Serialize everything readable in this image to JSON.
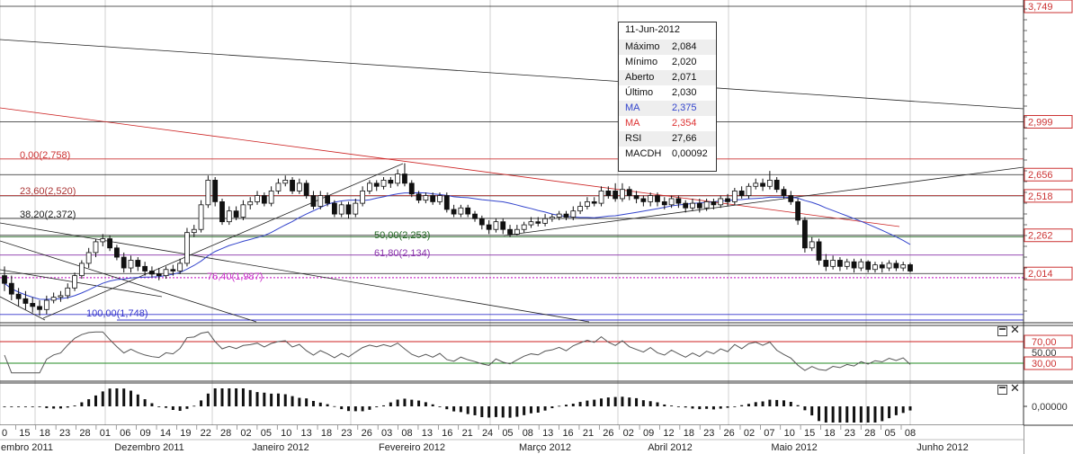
{
  "tooltip": {
    "date": "11-Jun-2012",
    "rows": [
      {
        "label": "Máximo",
        "value": "2,084",
        "color": "#111111"
      },
      {
        "label": "Mínimo",
        "value": "2,020",
        "color": "#111111"
      },
      {
        "label": "Aberto",
        "value": "2,071",
        "color": "#111111"
      },
      {
        "label": "Último",
        "value": "2,030",
        "color": "#111111"
      },
      {
        "label": "MA",
        "value": "2,375",
        "color": "#3344cc"
      },
      {
        "label": "MA",
        "value": "2,354",
        "color": "#dd3333"
      },
      {
        "label": "RSI",
        "value": "27,66",
        "color": "#111111"
      },
      {
        "label": "MACDH",
        "value": "0,00092",
        "color": "#111111"
      }
    ]
  },
  "chart_data": {
    "type": "candlestick",
    "price_axis": {
      "range": [
        1.7,
        3.79
      ],
      "ticks": [
        "3,749",
        "2,999",
        "2,656",
        "2,518",
        "2,262",
        "2,014"
      ]
    },
    "price_ticks_values": [
      3.749,
      2.999,
      2.656,
      2.518,
      2.262,
      2.014
    ],
    "fibonacci": [
      {
        "label": "0,00(2,758)",
        "value": 2.758,
        "color": "#cc3333"
      },
      {
        "label": "23,60(2,520)",
        "value": 2.52,
        "color": "#aa3333"
      },
      {
        "label": "38,20(2,372)",
        "value": 2.372,
        "color": "#222222"
      },
      {
        "label": "50,00(2,253)",
        "value": 2.253,
        "color": "#226622"
      },
      {
        "label": "61,80(2,134)",
        "value": 2.134,
        "color": "#8833aa"
      },
      {
        "label": "76,40(1,987)",
        "value": 1.987,
        "color": "#cc33cc"
      },
      {
        "label": "100,00(1,748)",
        "value": 1.748,
        "color": "#3333cc"
      }
    ],
    "candles": [
      [
        2.0,
        1.95,
        2.06,
        1.9
      ],
      [
        1.95,
        1.88,
        2.0,
        1.84
      ],
      [
        1.88,
        1.85,
        1.92,
        1.8
      ],
      [
        1.85,
        1.82,
        1.9,
        1.78
      ],
      [
        1.82,
        1.8,
        1.86,
        1.76
      ],
      [
        1.8,
        1.78,
        1.84,
        1.74
      ],
      [
        1.78,
        1.84,
        1.87,
        1.75
      ],
      [
        1.84,
        1.86,
        1.89,
        1.82
      ],
      [
        1.86,
        1.87,
        1.9,
        1.83
      ],
      [
        1.87,
        1.92,
        1.95,
        1.85
      ],
      [
        1.92,
        2.0,
        2.02,
        1.9
      ],
      [
        2.0,
        2.08,
        2.1,
        1.98
      ],
      [
        2.08,
        2.15,
        2.18,
        2.05
      ],
      [
        2.15,
        2.22,
        2.24,
        2.12
      ],
      [
        2.22,
        2.24,
        2.27,
        2.19
      ],
      [
        2.24,
        2.18,
        2.26,
        2.16
      ],
      [
        2.18,
        2.12,
        2.2,
        2.1
      ],
      [
        2.12,
        2.05,
        2.15,
        2.02
      ],
      [
        2.05,
        2.1,
        2.13,
        2.02
      ],
      [
        2.1,
        2.06,
        2.12,
        2.03
      ],
      [
        2.06,
        2.03,
        2.09,
        2.0
      ],
      [
        2.03,
        2.01,
        2.06,
        1.99
      ],
      [
        2.01,
        2.0,
        2.05,
        1.97
      ],
      [
        2.0,
        2.04,
        2.06,
        1.98
      ],
      [
        2.04,
        2.03,
        2.07,
        2.0
      ],
      [
        2.03,
        2.08,
        2.11,
        2.01
      ],
      [
        2.08,
        2.28,
        2.31,
        2.06
      ],
      [
        2.28,
        2.3,
        2.33,
        2.25
      ],
      [
        2.3,
        2.46,
        2.49,
        2.28
      ],
      [
        2.46,
        2.62,
        2.65,
        2.44
      ],
      [
        2.62,
        2.48,
        2.64,
        2.45
      ],
      [
        2.48,
        2.35,
        2.5,
        2.33
      ],
      [
        2.35,
        2.42,
        2.45,
        2.33
      ],
      [
        2.42,
        2.38,
        2.45,
        2.36
      ],
      [
        2.38,
        2.46,
        2.49,
        2.36
      ],
      [
        2.46,
        2.48,
        2.51,
        2.43
      ],
      [
        2.48,
        2.52,
        2.55,
        2.46
      ],
      [
        2.52,
        2.47,
        2.54,
        2.45
      ],
      [
        2.47,
        2.55,
        2.58,
        2.45
      ],
      [
        2.55,
        2.6,
        2.63,
        2.53
      ],
      [
        2.6,
        2.62,
        2.65,
        2.58
      ],
      [
        2.62,
        2.55,
        2.64,
        2.53
      ],
      [
        2.55,
        2.6,
        2.63,
        2.53
      ],
      [
        2.6,
        2.52,
        2.62,
        2.5
      ],
      [
        2.52,
        2.45,
        2.55,
        2.43
      ],
      [
        2.45,
        2.52,
        2.55,
        2.43
      ],
      [
        2.52,
        2.47,
        2.54,
        2.45
      ],
      [
        2.47,
        2.4,
        2.49,
        2.38
      ],
      [
        2.4,
        2.46,
        2.48,
        2.38
      ],
      [
        2.46,
        2.4,
        2.48,
        2.37
      ],
      [
        2.4,
        2.47,
        2.5,
        2.38
      ],
      [
        2.47,
        2.55,
        2.58,
        2.45
      ],
      [
        2.55,
        2.6,
        2.62,
        2.53
      ],
      [
        2.6,
        2.58,
        2.62,
        2.55
      ],
      [
        2.58,
        2.62,
        2.64,
        2.56
      ],
      [
        2.62,
        2.6,
        2.64,
        2.57
      ],
      [
        2.6,
        2.66,
        2.69,
        2.58
      ],
      [
        2.66,
        2.6,
        2.73,
        2.58
      ],
      [
        2.6,
        2.53,
        2.62,
        2.51
      ],
      [
        2.53,
        2.49,
        2.55,
        2.47
      ],
      [
        2.49,
        2.52,
        2.54,
        2.47
      ],
      [
        2.52,
        2.48,
        2.54,
        2.46
      ],
      [
        2.48,
        2.52,
        2.54,
        2.46
      ],
      [
        2.52,
        2.43,
        2.54,
        2.41
      ],
      [
        2.43,
        2.4,
        2.46,
        2.38
      ],
      [
        2.4,
        2.44,
        2.46,
        2.38
      ],
      [
        2.44,
        2.4,
        2.46,
        2.38
      ],
      [
        2.4,
        2.37,
        2.42,
        2.35
      ],
      [
        2.37,
        2.33,
        2.39,
        2.3
      ],
      [
        2.33,
        2.3,
        2.36,
        2.27
      ],
      [
        2.3,
        2.35,
        2.37,
        2.28
      ],
      [
        2.35,
        2.3,
        2.37,
        2.27
      ],
      [
        2.3,
        2.27,
        2.33,
        2.25
      ],
      [
        2.27,
        2.3,
        2.33,
        2.26
      ],
      [
        2.3,
        2.33,
        2.35,
        2.28
      ],
      [
        2.33,
        2.35,
        2.38,
        2.31
      ],
      [
        2.35,
        2.34,
        2.38,
        2.32
      ],
      [
        2.34,
        2.37,
        2.4,
        2.32
      ],
      [
        2.37,
        2.38,
        2.4,
        2.35
      ],
      [
        2.38,
        2.4,
        2.42,
        2.36
      ],
      [
        2.4,
        2.38,
        2.42,
        2.36
      ],
      [
        2.38,
        2.42,
        2.45,
        2.36
      ],
      [
        2.42,
        2.45,
        2.48,
        2.4
      ],
      [
        2.45,
        2.48,
        2.51,
        2.43
      ],
      [
        2.48,
        2.47,
        2.51,
        2.45
      ],
      [
        2.47,
        2.55,
        2.58,
        2.45
      ],
      [
        2.55,
        2.52,
        2.58,
        2.5
      ],
      [
        2.55,
        2.5,
        2.6,
        2.48
      ],
      [
        2.5,
        2.56,
        2.6,
        2.48
      ],
      [
        2.56,
        2.52,
        2.58,
        2.49
      ],
      [
        2.52,
        2.5,
        2.55,
        2.47
      ],
      [
        2.5,
        2.48,
        2.52,
        2.45
      ],
      [
        2.48,
        2.52,
        2.54,
        2.45
      ],
      [
        2.52,
        2.48,
        2.54,
        2.45
      ],
      [
        2.48,
        2.46,
        2.51,
        2.43
      ],
      [
        2.46,
        2.5,
        2.52,
        2.44
      ],
      [
        2.5,
        2.47,
        2.52,
        2.44
      ],
      [
        2.47,
        2.44,
        2.49,
        2.41
      ],
      [
        2.44,
        2.47,
        2.5,
        2.42
      ],
      [
        2.47,
        2.44,
        2.5,
        2.41
      ],
      [
        2.44,
        2.48,
        2.5,
        2.42
      ],
      [
        2.48,
        2.46,
        2.5,
        2.43
      ],
      [
        2.46,
        2.5,
        2.52,
        2.44
      ],
      [
        2.5,
        2.48,
        2.53,
        2.45
      ],
      [
        2.48,
        2.55,
        2.57,
        2.46
      ],
      [
        2.55,
        2.52,
        2.58,
        2.5
      ],
      [
        2.52,
        2.58,
        2.6,
        2.5
      ],
      [
        2.58,
        2.6,
        2.63,
        2.56
      ],
      [
        2.6,
        2.58,
        2.63,
        2.55
      ],
      [
        2.58,
        2.62,
        2.68,
        2.56
      ],
      [
        2.62,
        2.56,
        2.64,
        2.54
      ],
      [
        2.56,
        2.52,
        2.58,
        2.5
      ],
      [
        2.52,
        2.48,
        2.55,
        2.46
      ],
      [
        2.48,
        2.36,
        2.5,
        2.33
      ],
      [
        2.36,
        2.18,
        2.38,
        2.15
      ],
      [
        2.18,
        2.22,
        2.25,
        2.16
      ],
      [
        2.22,
        2.1,
        2.24,
        2.07
      ],
      [
        2.1,
        2.06,
        2.14,
        2.03
      ],
      [
        2.06,
        2.1,
        2.13,
        2.04
      ],
      [
        2.1,
        2.06,
        2.12,
        2.03
      ],
      [
        2.06,
        2.09,
        2.11,
        2.04
      ],
      [
        2.09,
        2.05,
        2.11,
        2.02
      ],
      [
        2.05,
        2.09,
        2.11,
        2.03
      ],
      [
        2.09,
        2.04,
        2.1,
        2.02
      ],
      [
        2.04,
        2.07,
        2.09,
        2.02
      ],
      [
        2.07,
        2.05,
        2.09,
        2.02
      ],
      [
        2.05,
        2.08,
        2.1,
        2.03
      ],
      [
        2.08,
        2.05,
        2.1,
        2.03
      ],
      [
        2.05,
        2.07,
        2.09,
        2.03
      ],
      [
        2.071,
        2.03,
        2.084,
        2.02
      ]
    ],
    "date_ticks": [
      "0",
      "15",
      "18",
      "23",
      "28",
      "01",
      "06",
      "09",
      "14",
      "19",
      "22",
      "28",
      "02",
      "05",
      "10",
      "13",
      "18",
      "23",
      "26",
      "03",
      "08",
      "13",
      "16",
      "21",
      "24",
      "05",
      "08",
      "13",
      "16",
      "21",
      "26",
      "02",
      "09",
      "12",
      "18",
      "23",
      "26",
      "02",
      "07",
      "10",
      "15",
      "18",
      "23",
      "28",
      "05",
      "08"
    ],
    "month_labels": [
      "embro 2011",
      "Dezembro 2011",
      "Janeiro 2012",
      "Fevereiro 2012",
      "Março 2012",
      "Abril 2012",
      "Maio 2012",
      "Junho 2012"
    ],
    "rsi": {
      "range": [
        0,
        100
      ],
      "ticks": [
        "70,00",
        "50,00",
        "30,00"
      ],
      "tick_values": [
        70,
        50,
        30
      ],
      "levels": [
        70,
        30
      ]
    },
    "macdh": {
      "tick": "0,00000"
    }
  }
}
